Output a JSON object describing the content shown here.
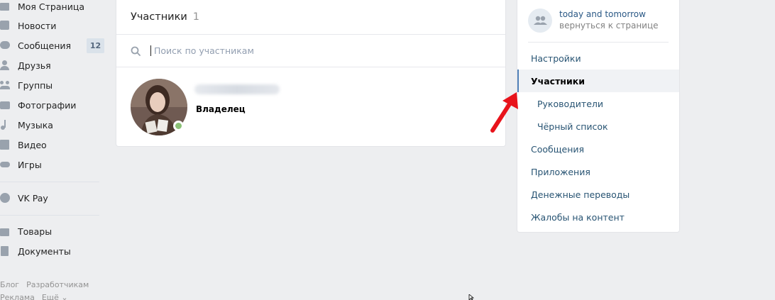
{
  "left_nav": {
    "items": [
      {
        "label": "Моя Страница",
        "icon": "home-icon"
      },
      {
        "label": "Новости",
        "icon": "news-icon"
      },
      {
        "label": "Сообщения",
        "icon": "messages-icon",
        "badge": "12"
      },
      {
        "label": "Друзья",
        "icon": "friends-icon"
      },
      {
        "label": "Группы",
        "icon": "groups-icon"
      },
      {
        "label": "Фотографии",
        "icon": "camera-icon"
      },
      {
        "label": "Музыка",
        "icon": "music-icon"
      },
      {
        "label": "Видео",
        "icon": "video-icon"
      },
      {
        "label": "Игры",
        "icon": "games-icon"
      },
      {
        "label": "VK Pay",
        "icon": "vkpay-icon"
      },
      {
        "label": "Товары",
        "icon": "shopping-bag-icon"
      },
      {
        "label": "Документы",
        "icon": "document-icon"
      }
    ],
    "footer": [
      "Блог",
      "Разработчикам",
      "Реклама",
      "Ещё ⌄"
    ]
  },
  "members": {
    "title": "Участники",
    "count": "1",
    "search_placeholder": "Поиск по участникам",
    "list": [
      {
        "role": "Владелец",
        "online": true
      }
    ]
  },
  "group": {
    "name": "today and tomorrow",
    "back_link": "вернуться к странице"
  },
  "menu": {
    "items": [
      {
        "label": "Настройки",
        "active": false,
        "sub": false
      },
      {
        "label": "Участники",
        "active": true,
        "sub": false
      },
      {
        "label": "Руководители",
        "active": false,
        "sub": true
      },
      {
        "label": "Чёрный список",
        "active": false,
        "sub": true
      },
      {
        "label": "Сообщения",
        "active": false,
        "sub": false
      },
      {
        "label": "Приложения",
        "active": false,
        "sub": false
      },
      {
        "label": "Денежные переводы",
        "active": false,
        "sub": false
      },
      {
        "label": "Жалобы на контент",
        "active": false,
        "sub": false
      }
    ]
  },
  "colors": {
    "link": "#285473",
    "accent": "#5181b8",
    "online": "#8ac176",
    "annotation_arrow": "#e8131b"
  }
}
